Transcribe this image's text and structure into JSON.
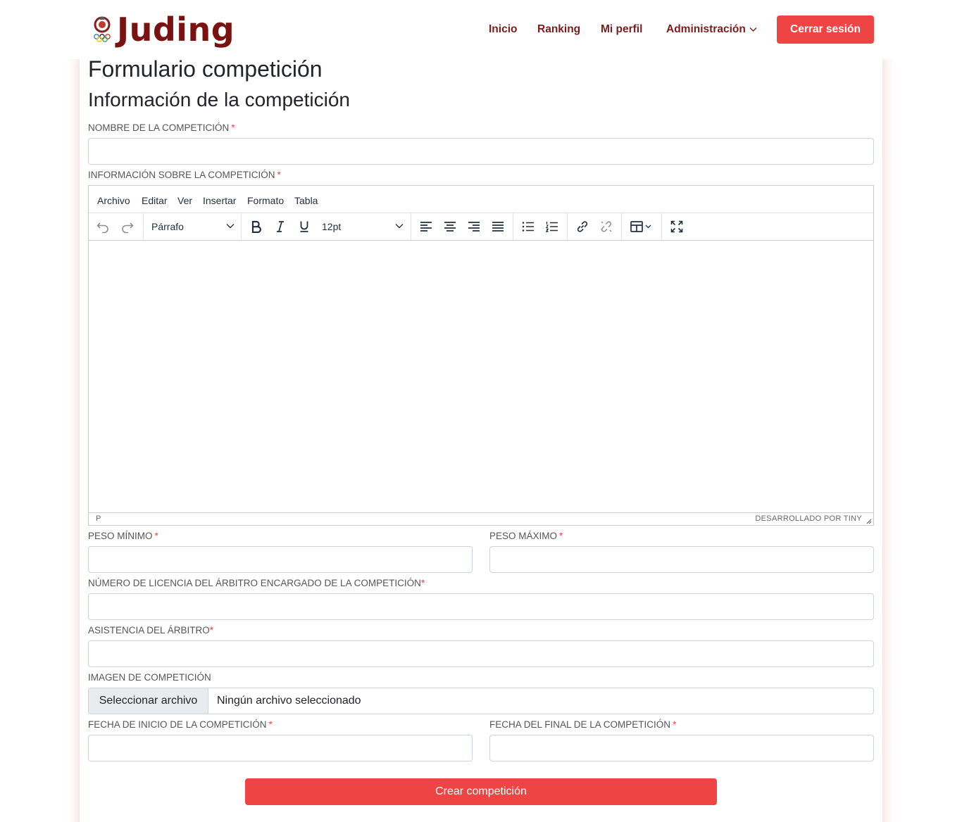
{
  "brand": {
    "name": "Juding",
    "emblem": "olympic-judo-emblem",
    "color": "#7a1212"
  },
  "nav": {
    "items": [
      {
        "label": "Inicio"
      },
      {
        "label": "Ranking"
      },
      {
        "label": "Mi perfil"
      },
      {
        "label": "Administración",
        "icon": "chevron-down-icon"
      }
    ],
    "logout_label": "Cerrar sesión"
  },
  "page": {
    "title": "Formulario competición",
    "section_title": "Información de la competición"
  },
  "form": {
    "name_label": "NOMBRE DE LA COMPETICIÓN",
    "info_label": "INFORMACIÓN SOBRE LA COMPETICIÓN",
    "min_weight_label": "PESO MÍNIMO",
    "max_weight_label": "PESO MÁXIMO",
    "referee_license_label": "NÚMERO DE LICENCIA DEL ÁRBITRO ENCARGADO DE LA COMPETICIÓN",
    "referee_attendance_label": "ASISTENCIA DEL ÁRBITRO",
    "image_label": "IMAGEN DE COMPETICIÓN",
    "start_date_label": "FECHA DE INICIO DE LA COMPETICIÓN",
    "end_date_label": "FECHA DEL FINAL DE LA COMPETICIÓN",
    "required_mark": "*",
    "file_button": "Seleccionar archivo",
    "file_status": "Ningún archivo seleccionado",
    "submit_label": "Crear competición"
  },
  "editor": {
    "menus": [
      "Archivo",
      "Editar",
      "Ver",
      "Insertar",
      "Formato",
      "Tabla"
    ],
    "block_format": "Párrafo",
    "font_size": "12pt",
    "status_path": "P",
    "powered_by": "DESARROLLADO POR TINY"
  },
  "colors": {
    "accent": "#ef4444",
    "nav_text": "#7a1c1c"
  }
}
